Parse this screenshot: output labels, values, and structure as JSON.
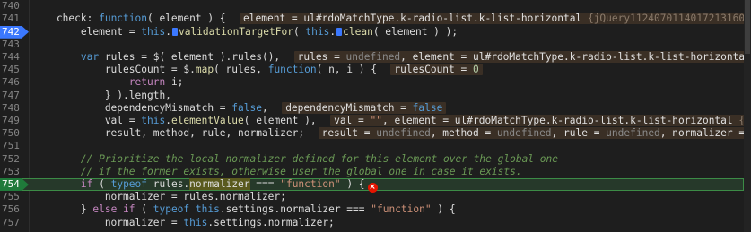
{
  "editor": {
    "lines": [
      {
        "n": "740",
        "tokens": []
      },
      {
        "n": "741",
        "tokens": [
          {
            "c": "plain",
            "t": "    check: "
          },
          {
            "c": "kw",
            "t": "function"
          },
          {
            "c": "plain",
            "t": "( element ) {  "
          },
          {
            "c": "inline",
            "parts": [
              {
                "c": "",
                "t": "element = ul#rdoMatchType.k-radio-list.k-list-horizontal "
              },
              {
                "c": "jq",
                "t": "{jQuery1124070114017213160​8"
              }
            ]
          }
        ]
      },
      {
        "n": "742",
        "bp": true,
        "tokens": [
          {
            "c": "plain",
            "t": "        element = "
          },
          {
            "c": "kw",
            "t": "this"
          },
          {
            "c": "plain",
            "t": "."
          },
          {
            "c": "marker"
          },
          {
            "c": "fn",
            "t": "validationTargetFor"
          },
          {
            "c": "plain",
            "t": "( "
          },
          {
            "c": "kw",
            "t": "this"
          },
          {
            "c": "plain",
            "t": "."
          },
          {
            "c": "marker"
          },
          {
            "c": "fn",
            "t": "clean"
          },
          {
            "c": "plain",
            "t": "( element ) );"
          }
        ]
      },
      {
        "n": "743",
        "tokens": []
      },
      {
        "n": "744",
        "tokens": [
          {
            "c": "plain",
            "t": "        "
          },
          {
            "c": "kw",
            "t": "var"
          },
          {
            "c": "plain",
            "t": " rules = $( element ).rules(),  "
          },
          {
            "c": "inline",
            "parts": [
              {
                "c": "",
                "t": "rules = "
              },
              {
                "c": "undef",
                "t": "undefined"
              },
              {
                "c": "",
                "t": ", element = ul#rdoMatchType.k-radio-list.k-list-horizontal"
              }
            ]
          }
        ]
      },
      {
        "n": "745",
        "tokens": [
          {
            "c": "plain",
            "t": "            rulesCount = $."
          },
          {
            "c": "fn",
            "t": "map"
          },
          {
            "c": "plain",
            "t": "( rules, "
          },
          {
            "c": "kw",
            "t": "function"
          },
          {
            "c": "plain",
            "t": "( n, i ) {  "
          },
          {
            "c": "inline",
            "parts": [
              {
                "c": "",
                "t": "rulesCount = "
              },
              {
                "c": "num",
                "t": "0"
              }
            ]
          }
        ]
      },
      {
        "n": "746",
        "tokens": [
          {
            "c": "plain",
            "t": "                "
          },
          {
            "c": "ret",
            "t": "return"
          },
          {
            "c": "plain",
            "t": " i;"
          }
        ]
      },
      {
        "n": "747",
        "tokens": [
          {
            "c": "plain",
            "t": "            } ).length,"
          }
        ]
      },
      {
        "n": "748",
        "tokens": [
          {
            "c": "plain",
            "t": "            dependencyMismatch = "
          },
          {
            "c": "kw",
            "t": "false"
          },
          {
            "c": "plain",
            "t": ",  "
          },
          {
            "c": "inline",
            "parts": [
              {
                "c": "",
                "t": "dependencyMismatch = "
              },
              {
                "c": "kw",
                "t": "false"
              }
            ]
          }
        ]
      },
      {
        "n": "749",
        "tokens": [
          {
            "c": "plain",
            "t": "            val = "
          },
          {
            "c": "kw",
            "t": "this"
          },
          {
            "c": "plain",
            "t": "."
          },
          {
            "c": "fn",
            "t": "elementValue"
          },
          {
            "c": "plain",
            "t": "( element ),  "
          },
          {
            "c": "inline",
            "parts": [
              {
                "c": "",
                "t": "val = "
              },
              {
                "c": "str",
                "t": "\"\""
              },
              {
                "c": "",
                "t": ", element = ul#rdoMatchType.k-radio-list.k-list-horizontal "
              },
              {
                "c": "jq",
                "t": "{jQ"
              }
            ]
          }
        ]
      },
      {
        "n": "750",
        "tokens": [
          {
            "c": "plain",
            "t": "            result, method, rule, normalizer;  "
          },
          {
            "c": "inline",
            "parts": [
              {
                "c": "",
                "t": "result = "
              },
              {
                "c": "undef",
                "t": "undefined"
              },
              {
                "c": "",
                "t": ", method = "
              },
              {
                "c": "undef",
                "t": "undefined"
              },
              {
                "c": "",
                "t": ", rule = "
              },
              {
                "c": "undef",
                "t": "undefined"
              },
              {
                "c": "",
                "t": ", normalizer = "
              },
              {
                "c": "undef",
                "t": "u"
              }
            ]
          }
        ]
      },
      {
        "n": "751",
        "tokens": []
      },
      {
        "n": "752",
        "tokens": [
          {
            "c": "cmt",
            "t": "        // Prioritize the local normalizer defined for this element over the global one"
          }
        ]
      },
      {
        "n": "753",
        "tokens": [
          {
            "c": "cmt",
            "t": "        // if the former exists, otherwise user the global one in case it exists."
          }
        ]
      },
      {
        "n": "754",
        "bp": true,
        "exec": true,
        "tokens": [
          {
            "c": "plain",
            "t": "        "
          },
          {
            "c": "kw2",
            "t": "if"
          },
          {
            "c": "plain",
            "t": " ( "
          },
          {
            "c": "kw",
            "t": "typeof"
          },
          {
            "c": "plain",
            "t": " rules."
          },
          {
            "c": "hl",
            "t": "normalizer"
          },
          {
            "c": "plain",
            "t": " === "
          },
          {
            "c": "str",
            "t": "\"function\""
          },
          {
            "c": "plain",
            "t": " ) {"
          },
          {
            "c": "err"
          }
        ]
      },
      {
        "n": "755",
        "tokens": [
          {
            "c": "plain",
            "t": "            normalizer = rules.normalizer;"
          }
        ]
      },
      {
        "n": "756",
        "tokens": [
          {
            "c": "plain",
            "t": "        } "
          },
          {
            "c": "kw2",
            "t": "else if"
          },
          {
            "c": "plain",
            "t": " ( "
          },
          {
            "c": "kw",
            "t": "typeof"
          },
          {
            "c": "plain",
            "t": " "
          },
          {
            "c": "kw",
            "t": "this"
          },
          {
            "c": "plain",
            "t": ".settings.normalizer === "
          },
          {
            "c": "str",
            "t": "\"function\""
          },
          {
            "c": "plain",
            "t": " ) {"
          }
        ]
      },
      {
        "n": "757",
        "tokens": [
          {
            "c": "plain",
            "t": "            normalizer = "
          },
          {
            "c": "kw",
            "t": "this"
          },
          {
            "c": "plain",
            "t": ".settings.normalizer;"
          }
        ]
      }
    ]
  },
  "colors": {
    "background": "#1e1e1e",
    "breakpoint": "#3b78ff",
    "current_line": "#26392a",
    "error": "#e51400"
  }
}
